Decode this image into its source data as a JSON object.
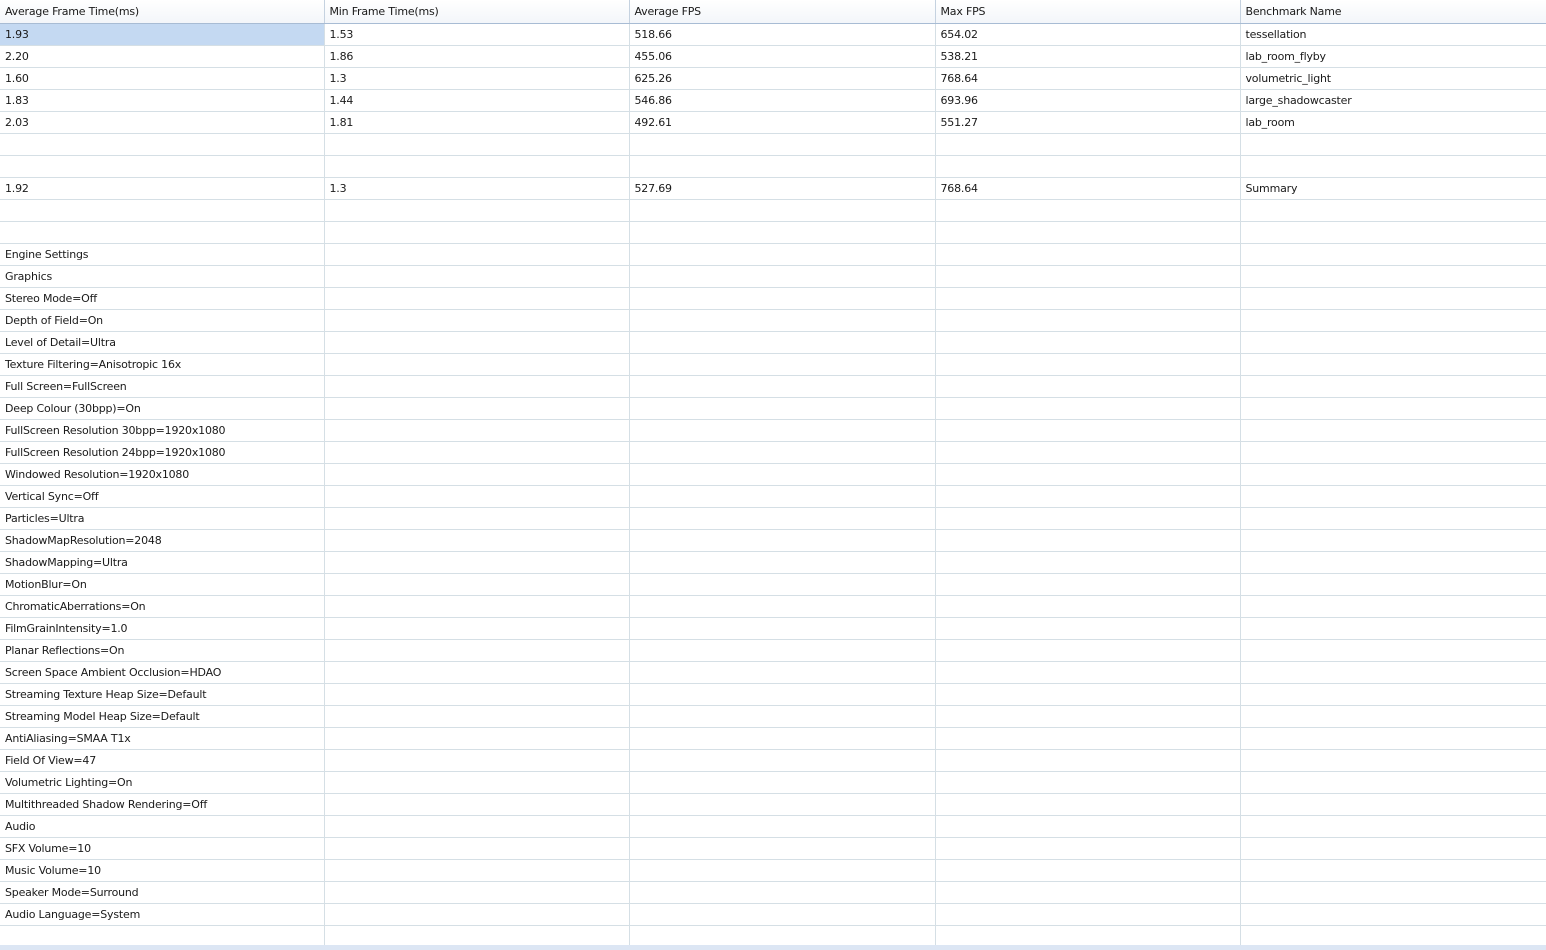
{
  "grid": {
    "columns": [
      "Average Frame Time(ms)",
      "Min Frame Time(ms)",
      "Average FPS",
      "Max FPS",
      "Benchmark Name"
    ],
    "selected_cell": [
      0,
      0
    ],
    "rows": [
      [
        "1.93",
        "1.53",
        "518.66",
        "654.02",
        "tessellation"
      ],
      [
        "2.20",
        "1.86",
        "455.06",
        "538.21",
        "lab_room_flyby"
      ],
      [
        "1.60",
        "1.3",
        "625.26",
        "768.64",
        "volumetric_light"
      ],
      [
        "1.83",
        "1.44",
        "546.86",
        "693.96",
        "large_shadowcaster"
      ],
      [
        "2.03",
        "1.81",
        "492.61",
        "551.27",
        "lab_room"
      ],
      [
        "",
        "",
        "",
        "",
        ""
      ],
      [
        "",
        "",
        "",
        "",
        ""
      ],
      [
        "1.92",
        "1.3",
        "527.69",
        "768.64",
        "Summary"
      ],
      [
        "",
        "",
        "",
        "",
        ""
      ],
      [
        "",
        "",
        "",
        "",
        ""
      ],
      [
        "Engine Settings",
        "",
        "",
        "",
        ""
      ],
      [
        "Graphics",
        "",
        "",
        "",
        ""
      ],
      [
        "Stereo Mode=Off",
        "",
        "",
        "",
        ""
      ],
      [
        "Depth of Field=On",
        "",
        "",
        "",
        ""
      ],
      [
        "Level of Detail=Ultra",
        "",
        "",
        "",
        ""
      ],
      [
        "Texture Filtering=Anisotropic 16x",
        "",
        "",
        "",
        ""
      ],
      [
        "Full Screen=FullScreen",
        "",
        "",
        "",
        ""
      ],
      [
        "Deep Colour (30bpp)=On",
        "",
        "",
        "",
        ""
      ],
      [
        "FullScreen Resolution 30bpp=1920x1080",
        "",
        "",
        "",
        ""
      ],
      [
        "FullScreen Resolution 24bpp=1920x1080",
        "",
        "",
        "",
        ""
      ],
      [
        "Windowed Resolution=1920x1080",
        "",
        "",
        "",
        ""
      ],
      [
        "Vertical Sync=Off",
        "",
        "",
        "",
        ""
      ],
      [
        "Particles=Ultra",
        "",
        "",
        "",
        ""
      ],
      [
        "ShadowMapResolution=2048",
        "",
        "",
        "",
        ""
      ],
      [
        "ShadowMapping=Ultra",
        "",
        "",
        "",
        ""
      ],
      [
        "MotionBlur=On",
        "",
        "",
        "",
        ""
      ],
      [
        "ChromaticAberrations=On",
        "",
        "",
        "",
        ""
      ],
      [
        "FilmGrainIntensity=1.0",
        "",
        "",
        "",
        ""
      ],
      [
        "Planar Reflections=On",
        "",
        "",
        "",
        ""
      ],
      [
        "Screen Space Ambient Occlusion=HDAO",
        "",
        "",
        "",
        ""
      ],
      [
        "Streaming Texture Heap Size=Default",
        "",
        "",
        "",
        ""
      ],
      [
        "Streaming Model Heap Size=Default",
        "",
        "",
        "",
        ""
      ],
      [
        "AntiAliasing=SMAA T1x",
        "",
        "",
        "",
        ""
      ],
      [
        "Field Of View=47",
        "",
        "",
        "",
        ""
      ],
      [
        "Volumetric Lighting=On",
        "",
        "",
        "",
        ""
      ],
      [
        "Multithreaded Shadow Rendering=Off",
        "",
        "",
        "",
        ""
      ],
      [
        "Audio",
        "",
        "",
        "",
        ""
      ],
      [
        "SFX Volume=10",
        "",
        "",
        "",
        ""
      ],
      [
        "Music Volume=10",
        "",
        "",
        "",
        ""
      ],
      [
        "Speaker Mode=Surround",
        "",
        "",
        "",
        ""
      ],
      [
        "Audio Language=System",
        "",
        "",
        "",
        ""
      ],
      [
        "",
        "",
        "",
        "",
        ""
      ]
    ]
  },
  "colors": {
    "selection": "#c4d9f2",
    "gridline": "#d5dfe5",
    "header_border": "#a8bcd4"
  }
}
